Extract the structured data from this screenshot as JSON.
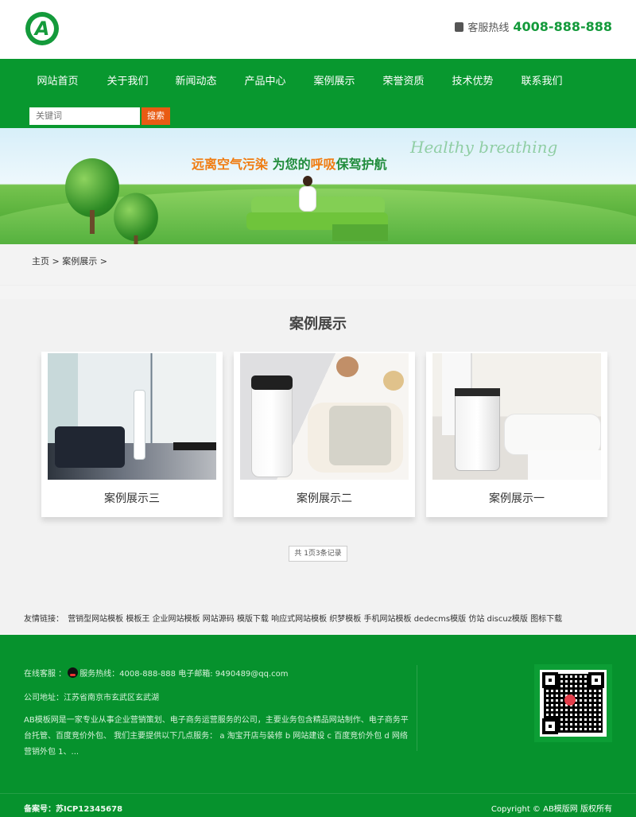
{
  "header": {
    "logo_letter": "A",
    "hotline_label": "客服热线",
    "hotline_number": "4008-888-888"
  },
  "nav": {
    "items": [
      "网站首页",
      "关于我们",
      "新闻动态",
      "产品中心",
      "案例展示",
      "荣誉资质",
      "技术优势",
      "联系我们"
    ],
    "search_placeholder": "关键词",
    "search_button": "搜索"
  },
  "banner": {
    "slogan_part1": "远离空气污染",
    "slogan_part2": "为您的",
    "slogan_part3": "呼吸",
    "slogan_part4": "保驾护航",
    "script_text": "Healthy breathing"
  },
  "breadcrumb": "主页 > 案例展示 >",
  "main": {
    "title": "案例展示",
    "cards": [
      {
        "caption": "案例展示三"
      },
      {
        "caption": "案例展示二"
      },
      {
        "caption": "案例展示一"
      }
    ],
    "pager": "共 1页3条记录"
  },
  "friend_links": {
    "label": "友情链接：",
    "items": [
      "营销型网站模板",
      "模板王",
      "企业网站模板",
      "网站源码",
      "模版下载",
      "响应式网站模板",
      "织梦模板",
      "手机网站模板",
      "dedecms模版",
      "仿站",
      "discuz模版",
      "图标下载"
    ]
  },
  "footer": {
    "online_service_label": "在线客服 ：",
    "service_text": "服务热线：4008-888-888 电子邮箱: 9490489@qq.com",
    "address": "公司地址：江苏省南京市玄武区玄武湖",
    "about": "AB模板网是一家专业从事企业营销策划、电子商务运营服务的公司，主要业务包含精品网站制作、电子商务平台托管、百度竞价外包、 我们主要提供以下几点服务： a 淘宝开店与装修 b 网站建设 c 百度竞价外包 d 网络营销外包 1、...",
    "icp": "备案号：苏ICP12345678",
    "copyright": "Copyright © AB模版网 版权所有"
  }
}
